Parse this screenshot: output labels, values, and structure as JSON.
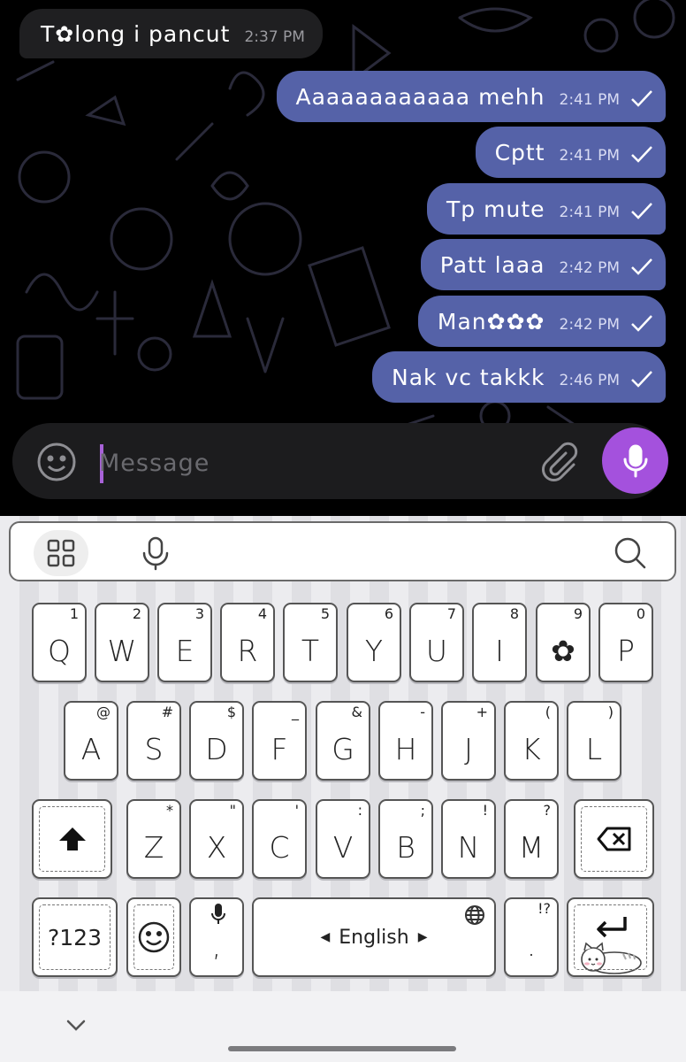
{
  "messages": [
    {
      "direction": "in",
      "text": "T✿long i pancut",
      "time": "2:37 PM"
    },
    {
      "direction": "out",
      "text": "Aaaaaaaaaaaa mehh",
      "time": "2:41 PM"
    },
    {
      "direction": "out",
      "text": "Cptt",
      "time": "2:41 PM"
    },
    {
      "direction": "out",
      "text": "Tp mute",
      "time": "2:41 PM"
    },
    {
      "direction": "out",
      "text": "Patt laaa",
      "time": "2:42 PM"
    },
    {
      "direction": "out",
      "text": "Man✿✿✿",
      "time": "2:42 PM"
    },
    {
      "direction": "out",
      "text": "Nak vc takkk",
      "time": "2:46 PM"
    }
  ],
  "composer": {
    "placeholder": "Message"
  },
  "colors": {
    "outgoing_bubble": "#5562a8",
    "incoming_bubble": "#1f1f21",
    "mic_button": "#a451dd",
    "caret": "#a862d8"
  },
  "icons": {
    "emoji": "smiley-icon",
    "attach": "paperclip-icon",
    "mic": "microphone-icon",
    "read": "check-icon"
  },
  "keyboard": {
    "toolbar": [
      "grid-icon",
      "microphone-icon",
      "search-icon"
    ],
    "row1": [
      {
        "k": "Q",
        "s": "1"
      },
      {
        "k": "W",
        "s": "2"
      },
      {
        "k": "E",
        "s": "3"
      },
      {
        "k": "R",
        "s": "4"
      },
      {
        "k": "T",
        "s": "5"
      },
      {
        "k": "Y",
        "s": "6"
      },
      {
        "k": "U",
        "s": "7"
      },
      {
        "k": "I",
        "s": "8"
      },
      {
        "k": "✿",
        "s": "9"
      },
      {
        "k": "P",
        "s": "0"
      }
    ],
    "row2": [
      {
        "k": "A",
        "s": "@"
      },
      {
        "k": "S",
        "s": "#"
      },
      {
        "k": "D",
        "s": "$"
      },
      {
        "k": "F",
        "s": "_"
      },
      {
        "k": "G",
        "s": "&"
      },
      {
        "k": "H",
        "s": "-"
      },
      {
        "k": "J",
        "s": "+"
      },
      {
        "k": "K",
        "s": "("
      },
      {
        "k": "L",
        "s": ")"
      }
    ],
    "row3": [
      {
        "k": "Z",
        "s": "*"
      },
      {
        "k": "X",
        "s": "\""
      },
      {
        "k": "C",
        "s": "'"
      },
      {
        "k": "V",
        "s": ":"
      },
      {
        "k": "B",
        "s": ";"
      },
      {
        "k": "N",
        "s": "!"
      },
      {
        "k": "M",
        "s": "?"
      }
    ],
    "symbols_label": "?123",
    "comma_label": ",",
    "space_label": "English",
    "period_label": ".",
    "period_sub": "!?"
  }
}
